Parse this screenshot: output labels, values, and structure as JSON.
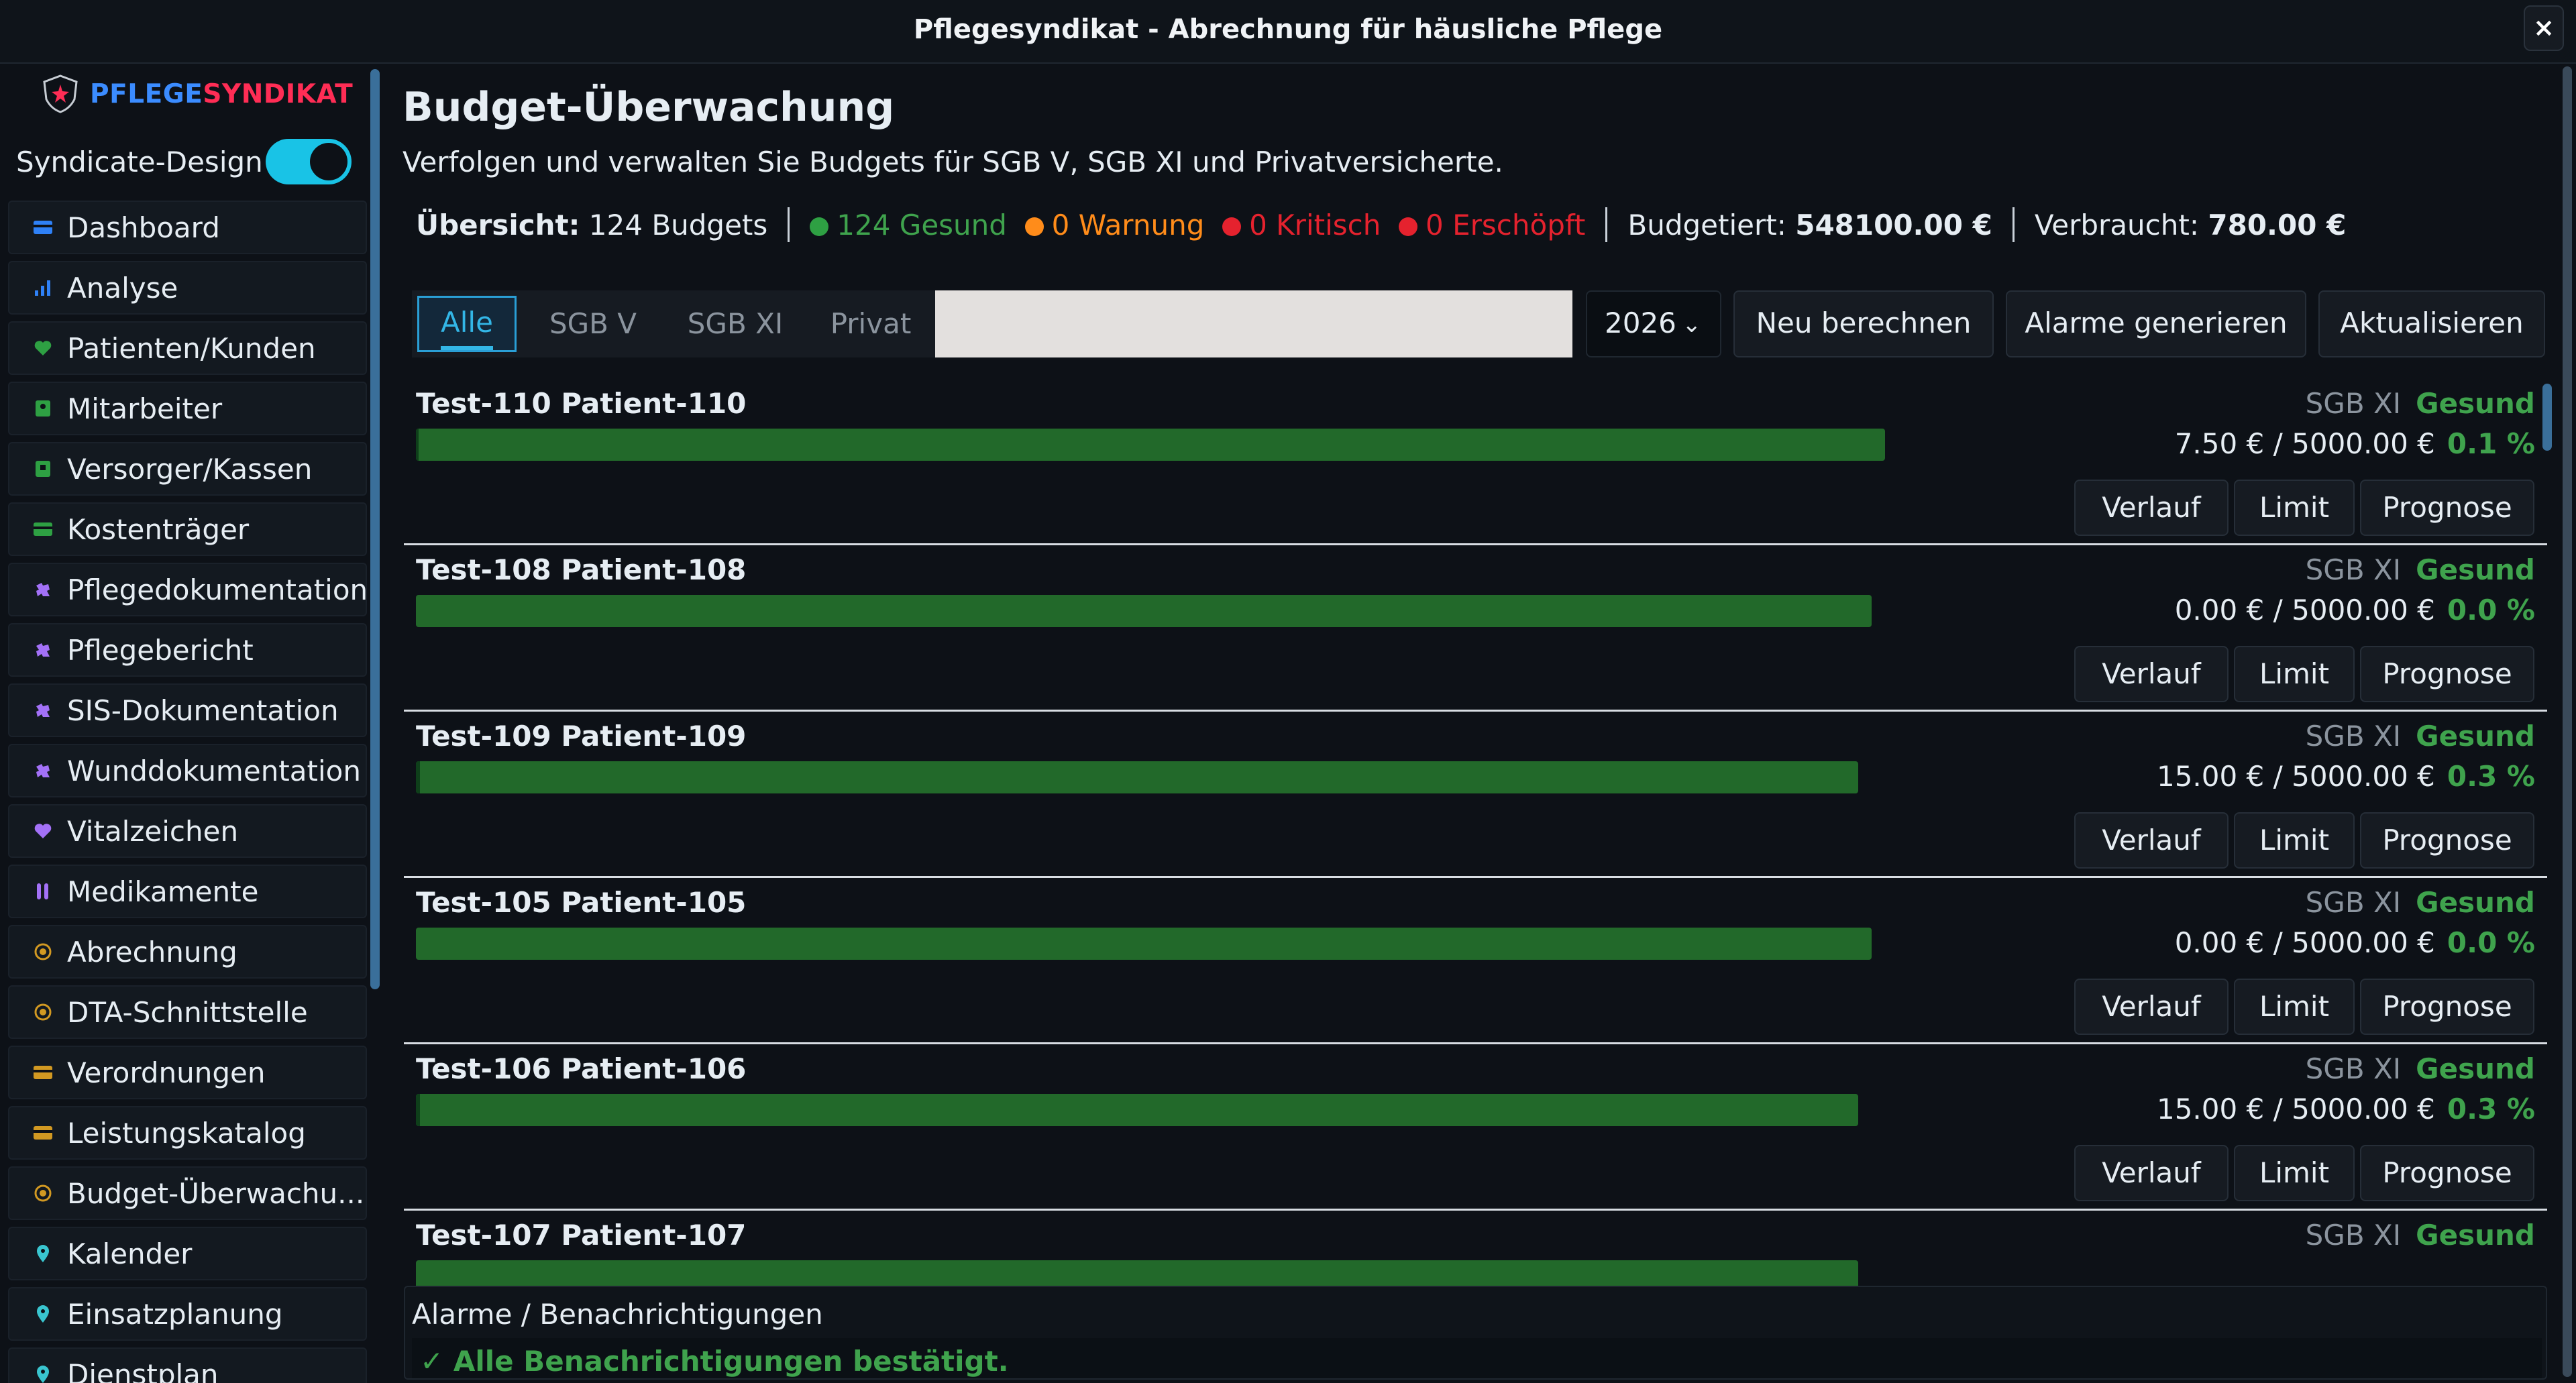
{
  "window": {
    "title": "Pflegesyndikat - Abrechnung für häusliche Pflege",
    "close_glyph": "×"
  },
  "sidebar": {
    "brand_part1": "PFLEGE",
    "brand_part2": "SYNDIKAT",
    "design_toggle_label": "Syndicate-Design",
    "design_toggle_on": true,
    "items": [
      {
        "label": "Dashboard",
        "icon": "card-icon",
        "color": "#2f81f7"
      },
      {
        "label": "Analyse",
        "icon": "bar-chart-icon",
        "color": "#2f81f7"
      },
      {
        "label": "Patienten/Kunden",
        "icon": "heart-icon",
        "color": "#2ea043"
      },
      {
        "label": "Mitarbeiter",
        "icon": "person-icon",
        "color": "#2ea043"
      },
      {
        "label": "Versorger/Kassen",
        "icon": "building-icon",
        "color": "#2ea043"
      },
      {
        "label": "Kostenträger",
        "icon": "card-icon",
        "color": "#2ea043"
      },
      {
        "label": "Pflegedokumentation",
        "icon": "puzzle-icon",
        "color": "#a371f7"
      },
      {
        "label": "Pflegebericht",
        "icon": "puzzle-icon",
        "color": "#a371f7"
      },
      {
        "label": "SIS-Dokumentation",
        "icon": "puzzle-icon",
        "color": "#a371f7"
      },
      {
        "label": "Wunddokumentation",
        "icon": "puzzle-icon",
        "color": "#a371f7"
      },
      {
        "label": "Vitalzeichen",
        "icon": "heart-icon",
        "color": "#a371f7"
      },
      {
        "label": "Medikamente",
        "icon": "pills-icon",
        "color": "#a371f7"
      },
      {
        "label": "Abrechnung",
        "icon": "coin-icon",
        "color": "#d29922"
      },
      {
        "label": "DTA-Schnittstelle",
        "icon": "coin-icon",
        "color": "#d29922"
      },
      {
        "label": "Verordnungen",
        "icon": "card-icon",
        "color": "#d29922"
      },
      {
        "label": "Leistungskatalog",
        "icon": "card-icon",
        "color": "#d29922"
      },
      {
        "label": "Budget-Überwachu...",
        "icon": "coin-icon",
        "color": "#d29922"
      },
      {
        "label": "Kalender",
        "icon": "pin-icon",
        "color": "#39c5cf"
      },
      {
        "label": "Einsatzplanung",
        "icon": "pin-icon",
        "color": "#39c5cf"
      },
      {
        "label": "Dienstplan",
        "icon": "pin-icon",
        "color": "#39c5cf"
      }
    ]
  },
  "main": {
    "title": "Budget-Überwachung",
    "subtitle": "Verfolgen und verwalten Sie Budgets für SGB V, SGB XI und Privatversicherte.",
    "summary": {
      "overview_label": "Übersicht:",
      "overview_value": "124 Budgets",
      "healthy": "124 Gesund",
      "warning": "0 Warnung",
      "critical": "0 Kritisch",
      "exhausted": "0 Erschöpft",
      "budgeted_label": "Budgetiert:",
      "budgeted_value": "548100.00 €",
      "used_label": "Verbraucht:",
      "used_value": "780.00 €"
    },
    "tabs": [
      "Alle",
      "SGB V",
      "SGB XI",
      "Privat"
    ],
    "active_tab": "Alle",
    "year": "2026",
    "buttons": {
      "recalc": "Neu berechnen",
      "alarms": "Alarme generieren",
      "refresh": "Aktualisieren"
    },
    "row_buttons": {
      "history": "Verlauf",
      "limit": "Limit",
      "forecast": "Prognose"
    },
    "budgets": [
      {
        "name": "Test-110 Patient-110",
        "kind": "SGB XI",
        "status": "Gesund",
        "amount": "7.50 € / 5000.00 €",
        "percent": "0.1 %",
        "used_fraction": 0.0015
      },
      {
        "name": "Test-108 Patient-108",
        "kind": "SGB XI",
        "status": "Gesund",
        "amount": "0.00 € / 5000.00 €",
        "percent": "0.0 %",
        "used_fraction": 0.0
      },
      {
        "name": "Test-109 Patient-109",
        "kind": "SGB XI",
        "status": "Gesund",
        "amount": "15.00 € / 5000.00 €",
        "percent": "0.3 %",
        "used_fraction": 0.003
      },
      {
        "name": "Test-105 Patient-105",
        "kind": "SGB XI",
        "status": "Gesund",
        "amount": "0.00 € / 5000.00 €",
        "percent": "0.0 %",
        "used_fraction": 0.0
      },
      {
        "name": "Test-106 Patient-106",
        "kind": "SGB XI",
        "status": "Gesund",
        "amount": "15.00 € / 5000.00 €",
        "percent": "0.3 %",
        "used_fraction": 0.003
      },
      {
        "name": "Test-107 Patient-107",
        "kind": "SGB XI",
        "status": "Gesund",
        "amount": "",
        "percent": "",
        "used_fraction": 0.0
      }
    ],
    "notifications": {
      "title": "Alarme / Benachrichtigungen",
      "message": "✓ Alle Benachrichtigungen bestätigt."
    }
  }
}
